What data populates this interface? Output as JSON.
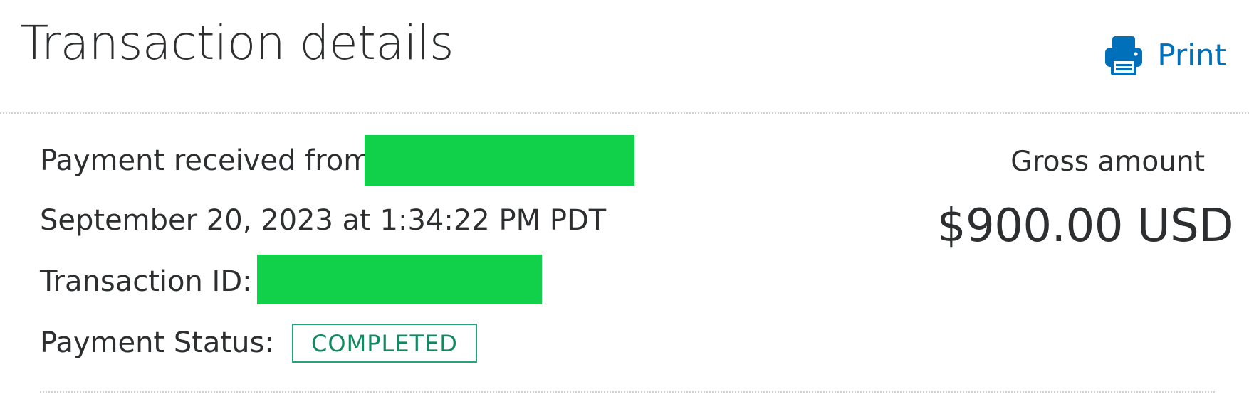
{
  "header": {
    "title": "Transaction details",
    "print_label": "Print",
    "print_icon": "printer-icon"
  },
  "details": {
    "payment_from_label": "Payment received from",
    "datetime": "September 20, 2023 at 1:34:22 PM PDT",
    "transaction_id_label": "Transaction ID:",
    "payment_status_label": "Payment Status:",
    "status_value": "COMPLETED"
  },
  "amount": {
    "label": "Gross amount",
    "value": "$900.00 USD"
  },
  "colors": {
    "accent": "#0070ba",
    "text": "#2c2e2f",
    "status_green": "#118a5f",
    "redaction": "#11d04a"
  }
}
